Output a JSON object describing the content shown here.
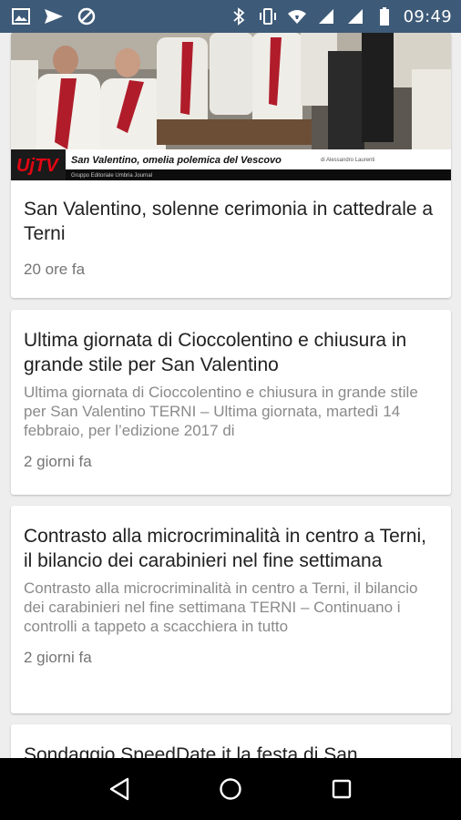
{
  "status_bar": {
    "time": "09:49",
    "colors": {
      "background": "#3d5a78"
    },
    "left_icons": [
      "image-icon",
      "send-icon",
      "blocked-icon"
    ],
    "right_icons": [
      "bluetooth-icon",
      "vibrate-icon",
      "wifi-icon",
      "signal-icon",
      "signal-icon",
      "battery-icon"
    ]
  },
  "feed": {
    "articles": [
      {
        "banner": {
          "logo": "UjTV",
          "caption": "San Valentino, omelia polemica del Vescovo",
          "author": "di Alessandro Laurenti",
          "subcaption": "Gruppo Editoriale Umbria Journal"
        },
        "title": "San Valentino, solenne cerimonia in cattedrale a Terni",
        "excerpt": "",
        "time": "20 ore fa"
      },
      {
        "title": "Ultima giornata di Cioccolentino e chiusura in grande stile per San Valentino",
        "excerpt": "Ultima giornata di Cioccolentino e chiusura  in grande stile per San Valentino    TERNI – Ultima giornata, martedì 14 febbraio, per l’edizione 2017 di",
        "time": "2 giorni fa"
      },
      {
        "title": "Contrasto alla microcriminalità in centro a Terni, il bilancio dei carabinieri nel fine settimana",
        "excerpt": "Contrasto alla microcriminalità in centro a Terni, il bilancio dei carabinieri nel fine settimana TERNI – Continuano i controlli a tappeto a scacchiera in tutto",
        "time": "2 giorni fa"
      },
      {
        "title": "Sondaggio SpeedDate.it la festa di San"
      }
    ]
  },
  "nav_bar": {
    "buttons": [
      "back-icon",
      "home-icon",
      "recents-icon"
    ]
  }
}
